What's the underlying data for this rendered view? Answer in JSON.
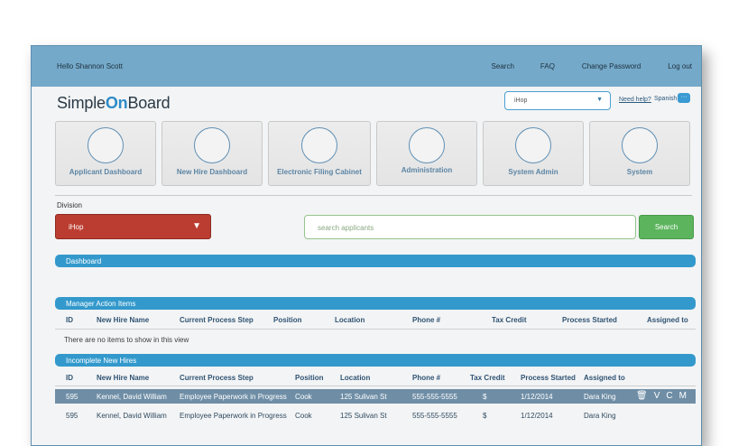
{
  "topbar": {
    "greeting": "Hello Shannon Scott",
    "nav": [
      "Search",
      "FAQ",
      "Change Password",
      "Log out"
    ]
  },
  "logo": {
    "part1": "Simple",
    "part2": "On",
    "part3": "Board"
  },
  "header": {
    "division_select": "iHop",
    "need_help": "Need help?",
    "spanish": "Spanish"
  },
  "tiles": [
    "Applicant Dashboard",
    "New Hire Dashboard",
    "Electronic Filing Cabinet",
    "Administration",
    "System Admin",
    "System"
  ],
  "division": {
    "label": "Division",
    "selected": "iHop"
  },
  "search": {
    "placeholder": "search applicants",
    "button": "Search"
  },
  "sections": {
    "dashboard": "Dashboard",
    "manager_action": "Manager Action Items",
    "incomplete": "Incomplete New Hires"
  },
  "manager_table": {
    "columns": [
      "ID",
      "New Hire Name",
      "Current Process Step",
      "Position",
      "Location",
      "Phone #",
      "Tax Credit",
      "Process Started",
      "Assigned to"
    ],
    "empty_message": "There are no items to show in this view"
  },
  "incomplete_table": {
    "columns": [
      "ID",
      "New Hire Name",
      "Current Process Step",
      "Position",
      "Location",
      "Phone #",
      "Tax Credit",
      "Process Started",
      "Assigned to"
    ],
    "rows": [
      [
        "595",
        "Kennel, David William",
        "Employee Paperwork in Progress",
        "Cook",
        "125 Sulivan St",
        "555-555-5555",
        "$",
        "1/12/2014",
        "Dara King"
      ],
      [
        "595",
        "Kennel, David William",
        "Employee Paperwork in Progress",
        "Cook",
        "125 Sulivan St",
        "555-555-5555",
        "$",
        "1/12/2014",
        "Dara King"
      ]
    ],
    "row_actions": [
      "V",
      "C",
      "M"
    ]
  },
  "colors": {
    "topbar": "#75a9c9",
    "section_bar": "#3399cc",
    "division_select": "#bb3d31",
    "search_button": "#5cb45d",
    "selected_row": "#6f8ea6"
  }
}
